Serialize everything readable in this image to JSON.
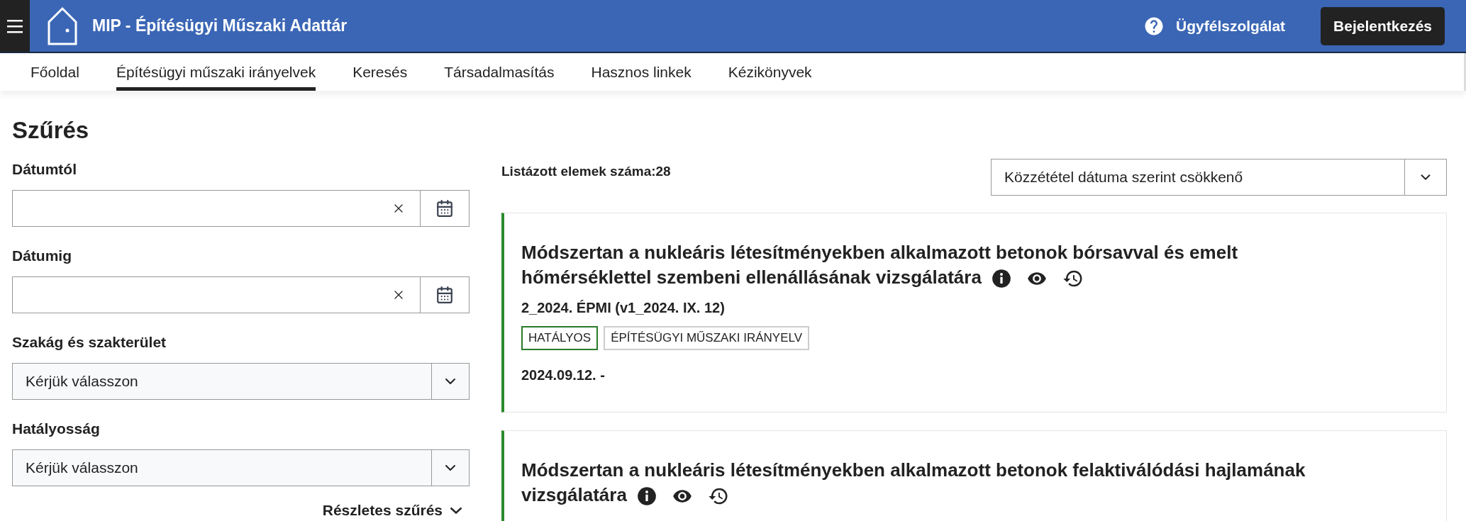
{
  "header": {
    "title": "MIP - Építésügyi Műszaki Adattár",
    "help": "Ügyfélszolgálat",
    "login": "Bejelentkezés"
  },
  "nav": [
    {
      "label": "Főoldal",
      "selected": false
    },
    {
      "label": "Építésügyi műszaki irányelvek",
      "selected": true
    },
    {
      "label": "Keresés",
      "selected": false
    },
    {
      "label": "Társadalmasítás",
      "selected": false
    },
    {
      "label": "Hasznos linkek",
      "selected": false
    },
    {
      "label": "Kézikönyvek",
      "selected": false
    }
  ],
  "filter": {
    "title": "Szűrés",
    "fields": [
      {
        "kind": "date",
        "label": "Dátumtól"
      },
      {
        "kind": "date",
        "label": "Dátumig"
      },
      {
        "kind": "select",
        "label": "Szakág és szakterület",
        "value": "Kérjük válasszon"
      },
      {
        "kind": "select",
        "label": "Hatályosság",
        "value": "Kérjük válasszon"
      }
    ],
    "more": "Részletes szűrés"
  },
  "results": {
    "count": "Listázott elemek száma:28",
    "sort": "Közzététel dátuma szerint csökkenő",
    "items": [
      {
        "title": "Módszertan a nukleáris létesítményekben alkalmazott betonok bórsavval és emelt hőmérséklettel szembeni ellenállásának vizsgálatára",
        "code": "2_2024. ÉPMI (v1_2024. IX. 12)",
        "tags": [
          {
            "kind": "status",
            "label": "HATÁLYOS"
          },
          {
            "kind": "type",
            "label": "ÉPÍTÉSÜGYI MŰSZAKI IRÁNYELV"
          }
        ],
        "date": "2024.09.12. -"
      },
      {
        "title": "Módszertan a nukleáris létesítményekben alkalmazott betonok felaktiválódási hajlamának vizsgálatára"
      }
    ]
  }
}
